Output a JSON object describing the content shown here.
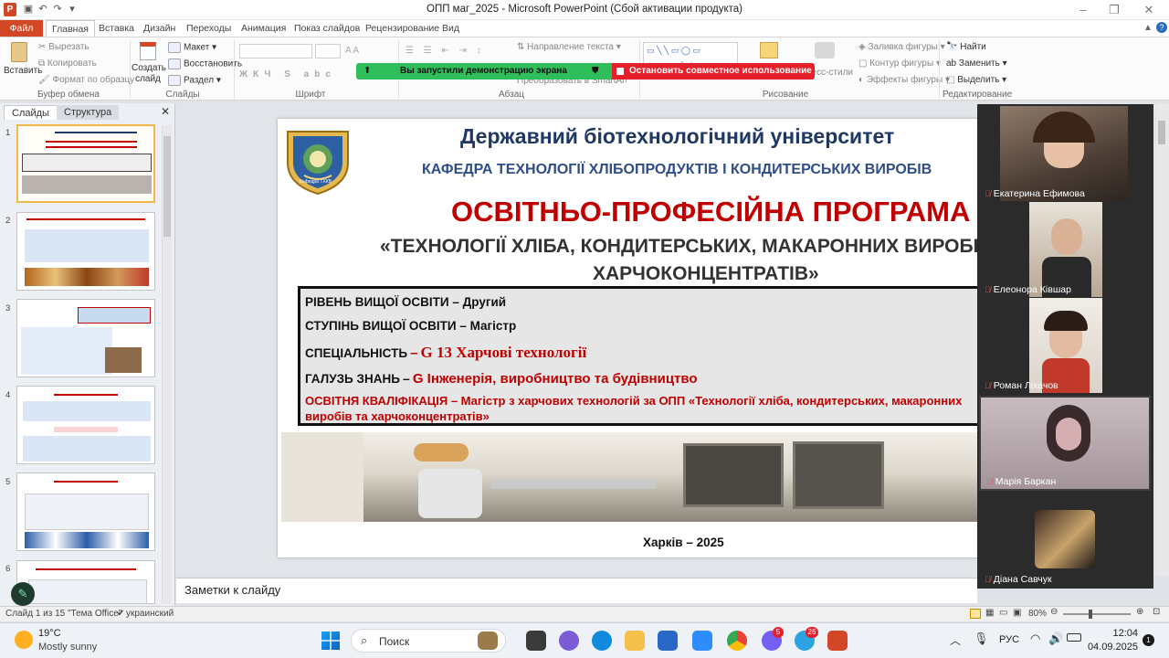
{
  "window": {
    "title": "ОПП маг_2025  -  Microsoft PowerPoint (Сбой активации продукта)"
  },
  "tabs": [
    {
      "label": "Файл"
    },
    {
      "label": "Главная"
    },
    {
      "label": "Вставка"
    },
    {
      "label": "Дизайн"
    },
    {
      "label": "Переходы"
    },
    {
      "label": "Анимация"
    },
    {
      "label": "Показ слайдов"
    },
    {
      "label": "Рецензирование"
    },
    {
      "label": "Вид"
    }
  ],
  "ribbon": {
    "clipboard": {
      "paste": "Вставить",
      "cut": "Вырезать",
      "copy": "Копировать",
      "format_painter": "Формат по образцу",
      "group": "Буфер обмена"
    },
    "slides": {
      "new_slide": "Создать слайд",
      "layout": "Макет",
      "reset": "Восстановить",
      "section": "Раздел",
      "group": "Слайды"
    },
    "font": {
      "group": "Шрифт"
    },
    "paragraph": {
      "text_direction": "Направление текста",
      "convert": "Преобразовать в SmartArt",
      "group": "Абзац"
    },
    "drawing": {
      "quick_styles": "Экспресс-стили",
      "fill": "Заливка фигуры",
      "outline": "Контур фигуры",
      "effects": "Эффекты фигуры",
      "group": "Рисование"
    },
    "editing": {
      "find": "Найти",
      "replace": "Заменить",
      "select": "Выделить",
      "group": "Редактирование"
    }
  },
  "share": {
    "running": "Вы запустили демонстрацию экрана",
    "stop": "Остановить совместное использование"
  },
  "left_panel": {
    "tab_slides": "Слайды",
    "tab_outline": "Структура",
    "thumbs": [
      "1",
      "2",
      "3",
      "4",
      "5",
      "6"
    ]
  },
  "slide": {
    "university": "Державний біотехнологічний університет",
    "department": "КАФЕДРА ТЕХНОЛОГІЇ ХЛІБОПРОДУКТІВ І КОНДИТЕРСЬКИХ ВИРОБІВ",
    "program_title": "ОСВІТНЬО-ПРОФЕСІЙНА ПРОГРАМА",
    "program_name_1": "«ТЕХНОЛОГІЇ ХЛІБА, КОНДИТЕРСЬКИХ, МАКАРОННИХ ВИРОБІВ І",
    "program_name_2": "ХАРЧОКОНЦЕНТРАТІВ»",
    "level_label": "РІВЕНЬ ВИЩОЇ ОСВІТИ",
    "level_value": "– Другий",
    "degree_label": "СТУПІНЬ ВИЩОЇ ОСВІТИ",
    "degree_value": "– Магістр",
    "specialty_label": "СПЕЦІАЛЬНІСТЬ",
    "specialty_dash": "–",
    "specialty_value": "G 13 Харчові технології",
    "field_label": "ГАЛУЗЬ ЗНАНЬ",
    "field_dash": "–",
    "field_value": "G Інженерія, виробництво та будівництво",
    "qualification_1": "ОСВІТНЯ КВАЛІФІКАЦІЯ – Магістр з харчових технологій за ОПП «Технології хліба, кондитерських, макаронних",
    "qualification_2": "виробів та харчоконцентратів»",
    "logo_caption": "Кафедра ТХКВ",
    "city_year": "Харків – 2025"
  },
  "notes": {
    "placeholder": "Заметки к слайду"
  },
  "participants": [
    {
      "name": "Екатерина Ефимова"
    },
    {
      "name": "Елеонора Ківшар"
    },
    {
      "name": "Роман Ліхачов"
    },
    {
      "name": "Марія Баркан"
    },
    {
      "name": "Діана Савчук"
    }
  ],
  "status": {
    "slide": "Слайд 1 из 15",
    "theme": "\"Тема Office\"",
    "language": "украинский",
    "zoom": "80%"
  },
  "taskbar": {
    "temp": "19°C",
    "weather": "Mostly sunny",
    "search": "Поиск",
    "lang": "РУС",
    "time": "12:04",
    "date": "04.09.2025",
    "notif": "1",
    "badge_viber": "5",
    "badge_tg": "26"
  },
  "colors": {
    "file_tab": "#d24726",
    "share_green": "#2fbe5a",
    "share_red": "#e5202b",
    "slide_red": "#c00000",
    "slide_blue": "#1f3864"
  }
}
